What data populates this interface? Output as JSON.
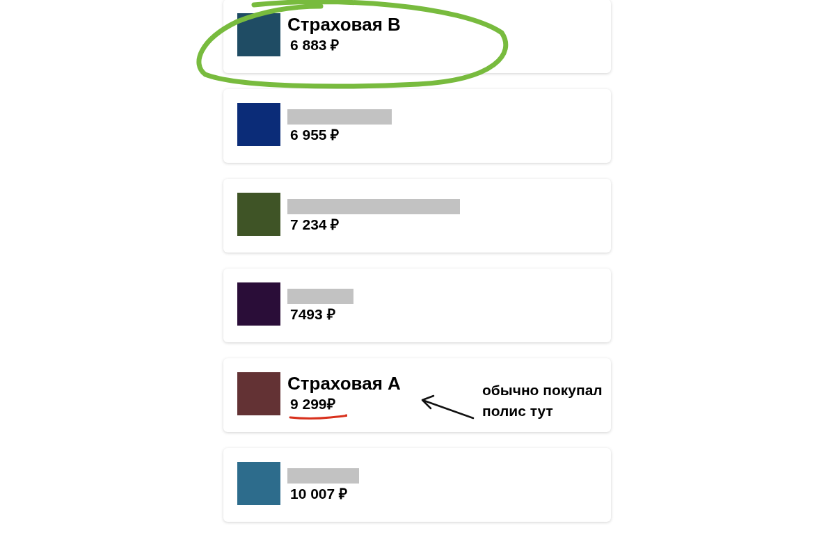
{
  "offers": [
    {
      "color": "#1f4c64",
      "name": "Страховая В",
      "price": "6 883 ₽",
      "circled": true,
      "underlined": false
    },
    {
      "color": "#0b2c78",
      "price": "6 955 ₽",
      "circled": false,
      "underlined": false
    },
    {
      "color": "#3f5426",
      "price": "7 234 ₽",
      "circled": false,
      "underlined": false
    },
    {
      "color": "#2a0d38",
      "price": "7493 ₽",
      "circled": false,
      "underlined": false
    },
    {
      "color": "#633234",
      "name": "Страховая А",
      "price": "9 299₽",
      "circled": false,
      "underlined": true,
      "note": [
        "обычно покупал",
        "полис тут"
      ]
    },
    {
      "color": "#2d6c8c",
      "price": "10 007 ₽",
      "circled": false,
      "underlined": false
    }
  ]
}
